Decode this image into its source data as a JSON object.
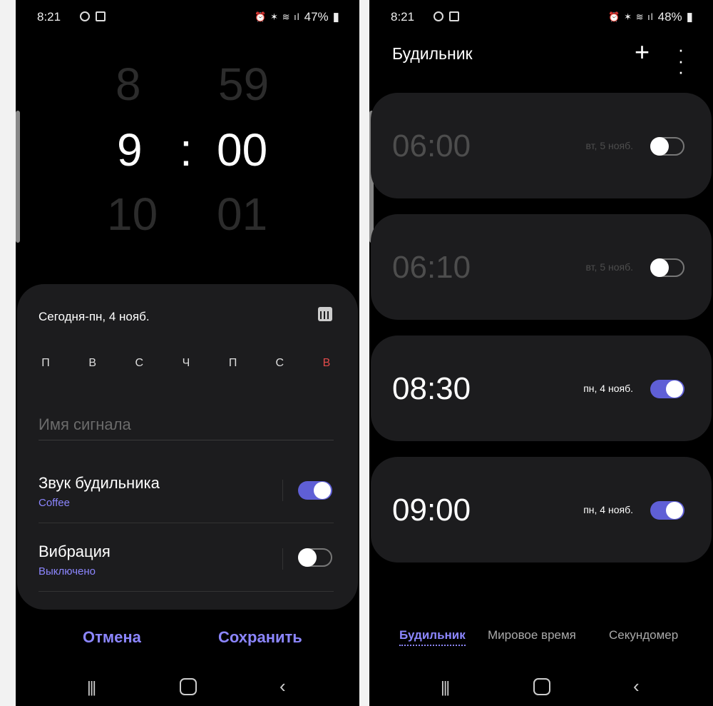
{
  "left_screen": {
    "status": {
      "time": "8:21",
      "battery": "47%"
    },
    "picker": {
      "hour_prev": "8",
      "hour": "9",
      "hour_next": "10",
      "separator": ":",
      "minute_prev": "59",
      "minute": "00",
      "minute_next": "01"
    },
    "date_label": "Сегодня-пн, 4 нояб.",
    "days": [
      "П",
      "В",
      "С",
      "Ч",
      "П",
      "С",
      "В"
    ],
    "alarm_name_placeholder": "Имя сигнала",
    "sound": {
      "title": "Звук будильника",
      "value": "Coffee",
      "enabled": true
    },
    "vibration": {
      "title": "Вибрация",
      "value": "Выключено",
      "enabled": false
    },
    "cancel_label": "Отмена",
    "save_label": "Сохранить"
  },
  "right_screen": {
    "status": {
      "time": "8:21",
      "battery": "48%"
    },
    "title": "Будильник",
    "alarms": [
      {
        "time": "06:00",
        "date": "вт, 5 нояб.",
        "enabled": false
      },
      {
        "time": "06:10",
        "date": "вт, 5 нояб.",
        "enabled": false
      },
      {
        "time": "08:30",
        "date": "пн, 4 нояб.",
        "enabled": true
      },
      {
        "time": "09:00",
        "date": "пн, 4 нояб.",
        "enabled": true
      }
    ],
    "tabs": [
      "Будильник",
      "Мировое время",
      "Секундомер"
    ]
  },
  "colors": {
    "accent": "#8c86ff",
    "toggle_on": "#5f5fd6",
    "sunday": "#e04a4a",
    "card": "#1c1c1e"
  }
}
